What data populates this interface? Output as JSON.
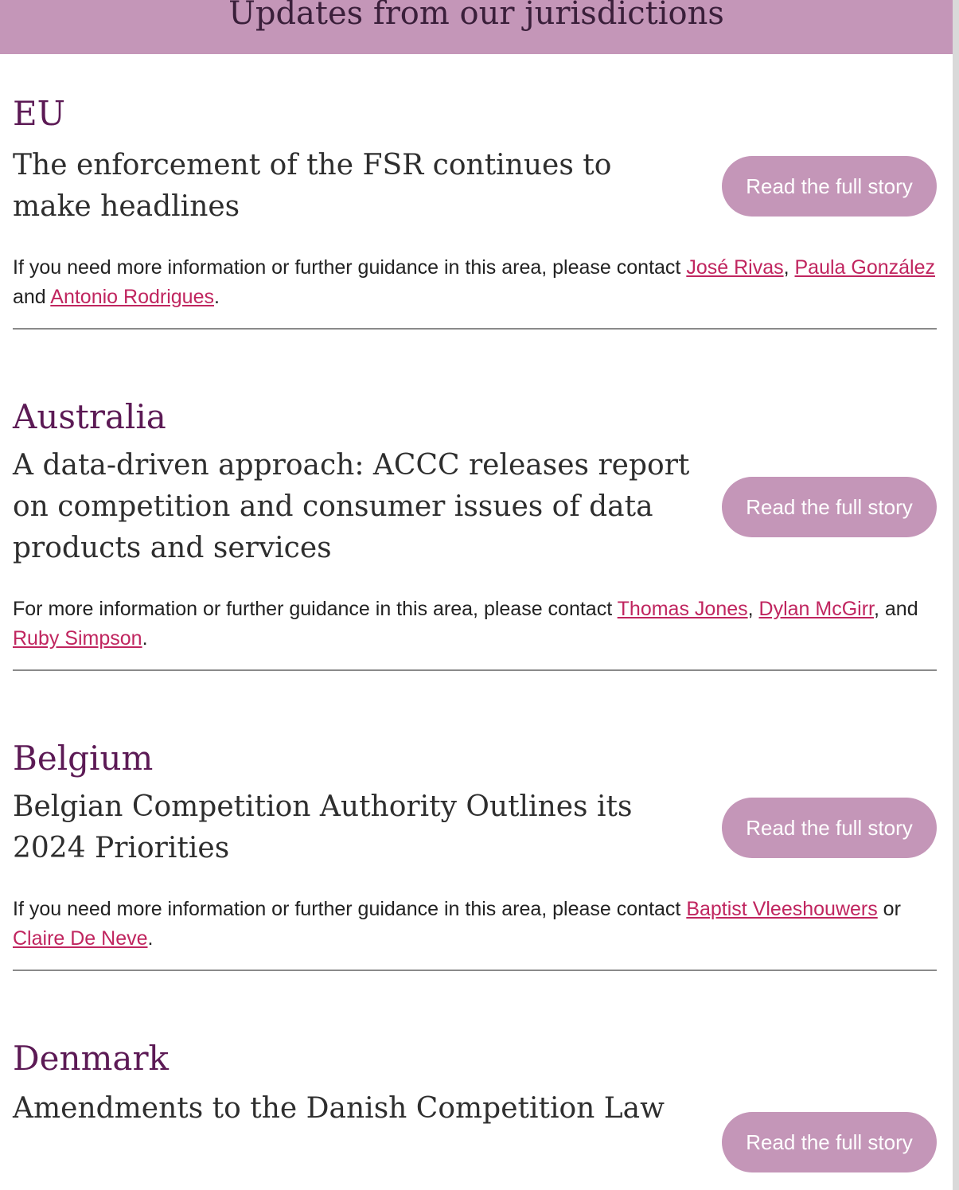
{
  "banner": {
    "title": "Updates from our jurisdictions"
  },
  "button_label": "Read the full story",
  "sections": [
    {
      "country": "EU",
      "story_title": "The enforcement of the FSR continues to make headlines",
      "contact_prefix": "If you need more information or further guidance in this area, please contact ",
      "links": [
        "José Rivas",
        "Paula González",
        "Antonio Rodrigues"
      ],
      "sep1": ", ",
      "sep2": " and ",
      "suffix": "."
    },
    {
      "country": "Australia",
      "story_title": "A data-driven approach: ACCC releases report on competition and consumer issues of data products and services",
      "contact_prefix": "For more information or further guidance in this area, please contact ",
      "links": [
        "Thomas Jones",
        "Dylan McGirr",
        "Ruby Simpson"
      ],
      "sep1": ", ",
      "sep2": ", and ",
      "suffix": "."
    },
    {
      "country": "Belgium",
      "story_title": "Belgian Competition Authority Outlines its 2024 Priorities",
      "contact_prefix": "If you need more information or further guidance in this area, please contact ",
      "links": [
        "Baptist Vleeshouwers",
        "Claire De Neve"
      ],
      "sep1": " or ",
      "suffix": "."
    },
    {
      "country": "Denmark",
      "story_title": "Amendments to the Danish Competition Law"
    }
  ]
}
